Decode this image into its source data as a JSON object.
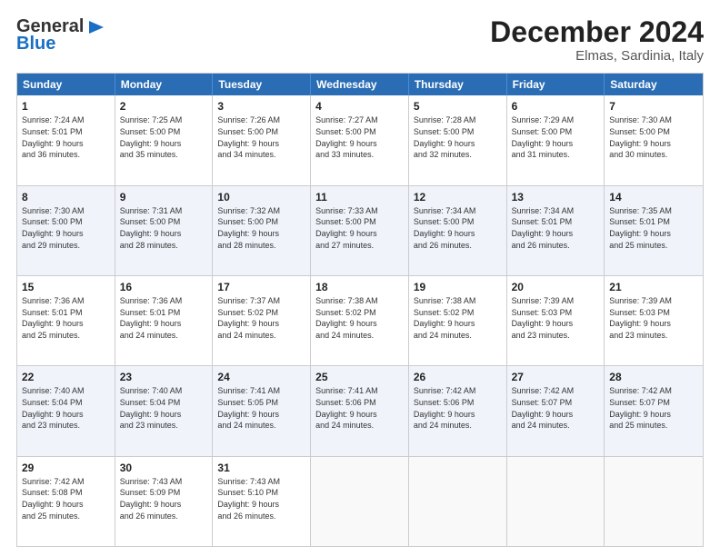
{
  "header": {
    "logo_line1": "General",
    "logo_line2": "Blue",
    "month": "December 2024",
    "location": "Elmas, Sardinia, Italy"
  },
  "days": [
    "Sunday",
    "Monday",
    "Tuesday",
    "Wednesday",
    "Thursday",
    "Friday",
    "Saturday"
  ],
  "rows": [
    [
      {
        "day": "1",
        "info": "Sunrise: 7:24 AM\nSunset: 5:01 PM\nDaylight: 9 hours\nand 36 minutes."
      },
      {
        "day": "2",
        "info": "Sunrise: 7:25 AM\nSunset: 5:00 PM\nDaylight: 9 hours\nand 35 minutes."
      },
      {
        "day": "3",
        "info": "Sunrise: 7:26 AM\nSunset: 5:00 PM\nDaylight: 9 hours\nand 34 minutes."
      },
      {
        "day": "4",
        "info": "Sunrise: 7:27 AM\nSunset: 5:00 PM\nDaylight: 9 hours\nand 33 minutes."
      },
      {
        "day": "5",
        "info": "Sunrise: 7:28 AM\nSunset: 5:00 PM\nDaylight: 9 hours\nand 32 minutes."
      },
      {
        "day": "6",
        "info": "Sunrise: 7:29 AM\nSunset: 5:00 PM\nDaylight: 9 hours\nand 31 minutes."
      },
      {
        "day": "7",
        "info": "Sunrise: 7:30 AM\nSunset: 5:00 PM\nDaylight: 9 hours\nand 30 minutes."
      }
    ],
    [
      {
        "day": "8",
        "info": "Sunrise: 7:30 AM\nSunset: 5:00 PM\nDaylight: 9 hours\nand 29 minutes."
      },
      {
        "day": "9",
        "info": "Sunrise: 7:31 AM\nSunset: 5:00 PM\nDaylight: 9 hours\nand 28 minutes."
      },
      {
        "day": "10",
        "info": "Sunrise: 7:32 AM\nSunset: 5:00 PM\nDaylight: 9 hours\nand 28 minutes."
      },
      {
        "day": "11",
        "info": "Sunrise: 7:33 AM\nSunset: 5:00 PM\nDaylight: 9 hours\nand 27 minutes."
      },
      {
        "day": "12",
        "info": "Sunrise: 7:34 AM\nSunset: 5:00 PM\nDaylight: 9 hours\nand 26 minutes."
      },
      {
        "day": "13",
        "info": "Sunrise: 7:34 AM\nSunset: 5:01 PM\nDaylight: 9 hours\nand 26 minutes."
      },
      {
        "day": "14",
        "info": "Sunrise: 7:35 AM\nSunset: 5:01 PM\nDaylight: 9 hours\nand 25 minutes."
      }
    ],
    [
      {
        "day": "15",
        "info": "Sunrise: 7:36 AM\nSunset: 5:01 PM\nDaylight: 9 hours\nand 25 minutes."
      },
      {
        "day": "16",
        "info": "Sunrise: 7:36 AM\nSunset: 5:01 PM\nDaylight: 9 hours\nand 24 minutes."
      },
      {
        "day": "17",
        "info": "Sunrise: 7:37 AM\nSunset: 5:02 PM\nDaylight: 9 hours\nand 24 minutes."
      },
      {
        "day": "18",
        "info": "Sunrise: 7:38 AM\nSunset: 5:02 PM\nDaylight: 9 hours\nand 24 minutes."
      },
      {
        "day": "19",
        "info": "Sunrise: 7:38 AM\nSunset: 5:02 PM\nDaylight: 9 hours\nand 24 minutes."
      },
      {
        "day": "20",
        "info": "Sunrise: 7:39 AM\nSunset: 5:03 PM\nDaylight: 9 hours\nand 23 minutes."
      },
      {
        "day": "21",
        "info": "Sunrise: 7:39 AM\nSunset: 5:03 PM\nDaylight: 9 hours\nand 23 minutes."
      }
    ],
    [
      {
        "day": "22",
        "info": "Sunrise: 7:40 AM\nSunset: 5:04 PM\nDaylight: 9 hours\nand 23 minutes."
      },
      {
        "day": "23",
        "info": "Sunrise: 7:40 AM\nSunset: 5:04 PM\nDaylight: 9 hours\nand 23 minutes."
      },
      {
        "day": "24",
        "info": "Sunrise: 7:41 AM\nSunset: 5:05 PM\nDaylight: 9 hours\nand 24 minutes."
      },
      {
        "day": "25",
        "info": "Sunrise: 7:41 AM\nSunset: 5:06 PM\nDaylight: 9 hours\nand 24 minutes."
      },
      {
        "day": "26",
        "info": "Sunrise: 7:42 AM\nSunset: 5:06 PM\nDaylight: 9 hours\nand 24 minutes."
      },
      {
        "day": "27",
        "info": "Sunrise: 7:42 AM\nSunset: 5:07 PM\nDaylight: 9 hours\nand 24 minutes."
      },
      {
        "day": "28",
        "info": "Sunrise: 7:42 AM\nSunset: 5:07 PM\nDaylight: 9 hours\nand 25 minutes."
      }
    ],
    [
      {
        "day": "29",
        "info": "Sunrise: 7:42 AM\nSunset: 5:08 PM\nDaylight: 9 hours\nand 25 minutes."
      },
      {
        "day": "30",
        "info": "Sunrise: 7:43 AM\nSunset: 5:09 PM\nDaylight: 9 hours\nand 26 minutes."
      },
      {
        "day": "31",
        "info": "Sunrise: 7:43 AM\nSunset: 5:10 PM\nDaylight: 9 hours\nand 26 minutes."
      },
      {
        "day": "",
        "info": ""
      },
      {
        "day": "",
        "info": ""
      },
      {
        "day": "",
        "info": ""
      },
      {
        "day": "",
        "info": ""
      }
    ]
  ]
}
